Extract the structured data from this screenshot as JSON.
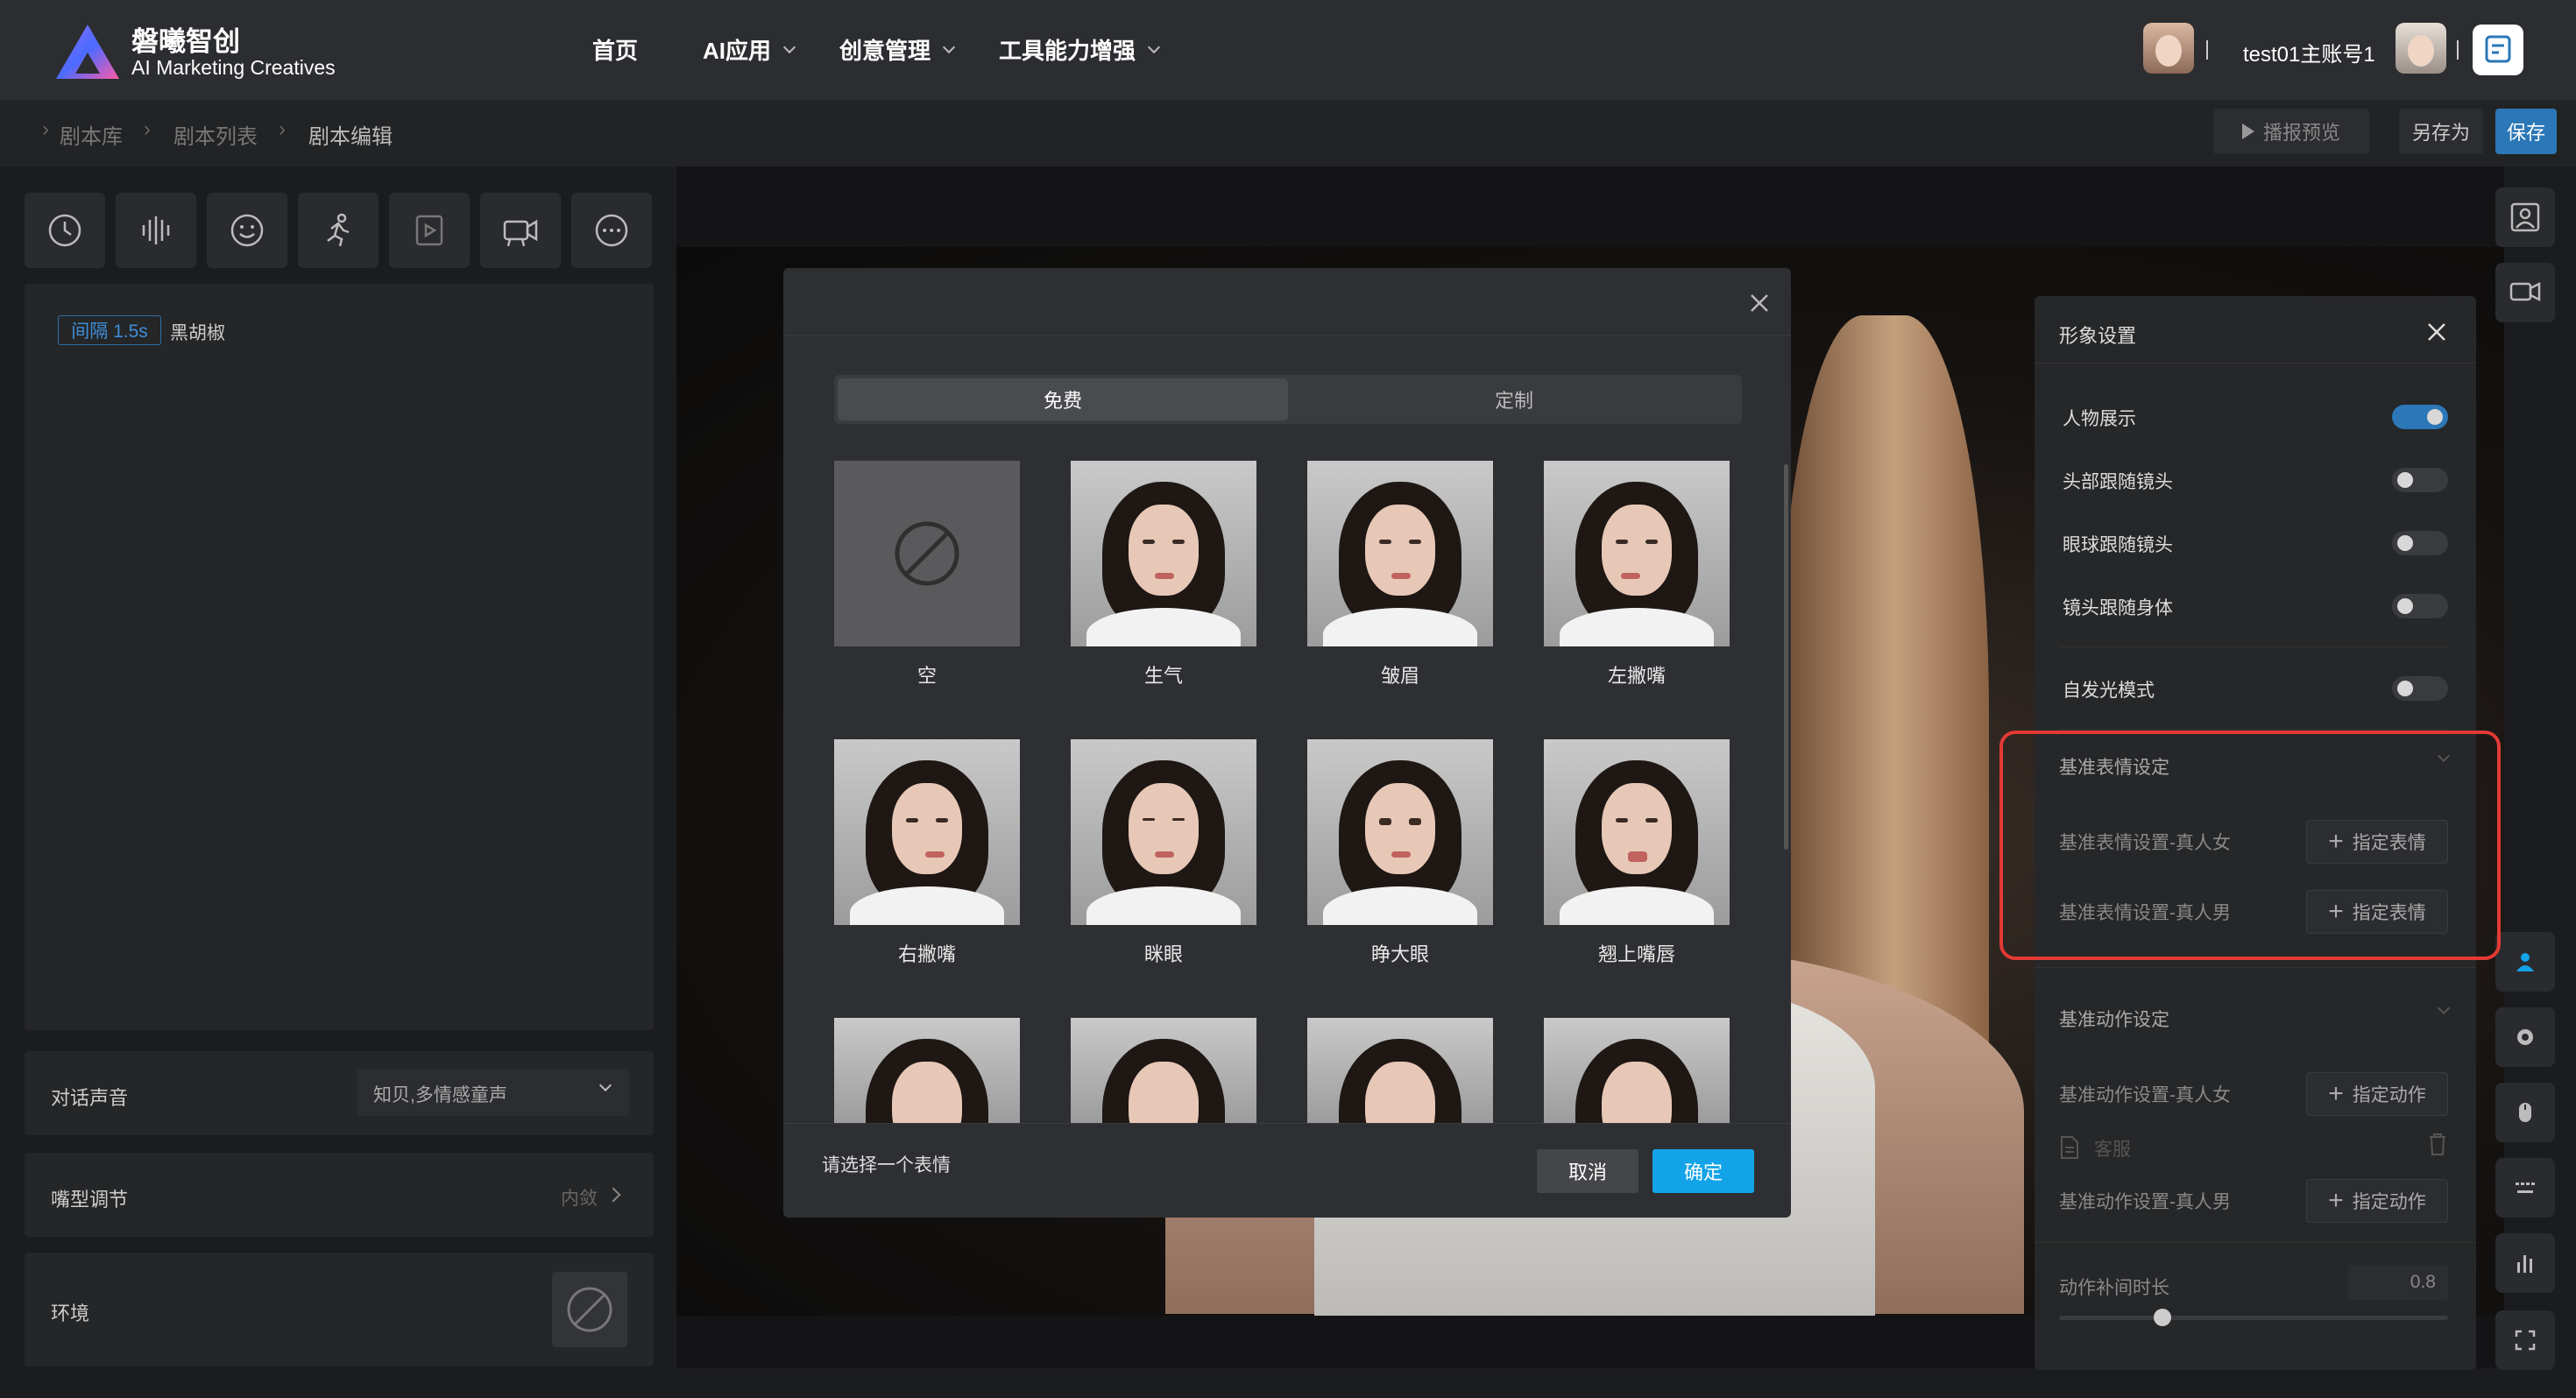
{
  "header": {
    "brand_title": "磐曦智创",
    "brand_subtitle": "AI Marketing Creatives",
    "nav": [
      {
        "label": "首页"
      },
      {
        "label": "AI应用"
      },
      {
        "label": "创意管理"
      },
      {
        "label": "工具能力增强"
      }
    ],
    "account_name": "test01主账号1"
  },
  "breadcrumb": [
    "剧本库",
    "剧本列表",
    "剧本编辑"
  ],
  "toolbar": {
    "preview_label": "播报预览",
    "save_as_label": "另存为",
    "save_label": "保存"
  },
  "left": {
    "tool_icons": [
      "clock-icon",
      "audio-wave-icon",
      "smile-icon",
      "run-icon",
      "video-play-icon",
      "camera-icon",
      "more-icon"
    ],
    "interval_tag": "间隔 1.5s",
    "interval_text": "黑胡椒",
    "voice_label": "对话声音",
    "voice_value": "知贝,多情感童声",
    "mouth_label": "嘴型调节",
    "mouth_value": "内敛",
    "env_label": "环境"
  },
  "modal": {
    "tabs": [
      "免费",
      "定制"
    ],
    "active_tab": "免费",
    "items": [
      "空",
      "生气",
      "皱眉",
      "左撇嘴",
      "右撇嘴",
      "眯眼",
      "睁大眼",
      "翘上嘴唇"
    ],
    "hint": "请选择一个表情",
    "cancel_label": "取消",
    "ok_label": "确定"
  },
  "settings": {
    "title": "形象设置",
    "toggles": [
      {
        "label": "人物展示",
        "on": true
      },
      {
        "label": "头部跟随镜头",
        "on": false
      },
      {
        "label": "眼球跟随镜头",
        "on": false
      },
      {
        "label": "镜头跟随身体",
        "on": false
      },
      {
        "label": "自发光模式",
        "on": false
      }
    ],
    "expr_section": "基准表情设定",
    "expr_female": "基准表情设置-真人女",
    "expr_male": "基准表情设置-真人男",
    "assign_expr": "指定表情",
    "action_section": "基准动作设定",
    "action_female": "基准动作设置-真人女",
    "action_female_value": "客服",
    "action_male": "基准动作设置-真人男",
    "assign_action": "指定动作",
    "tween_label": "动作补间时长",
    "tween_value": "0.8"
  },
  "colors": {
    "accent": "#13a3e8",
    "save_button": "#2b77b7",
    "highlight": "#e23a35"
  }
}
